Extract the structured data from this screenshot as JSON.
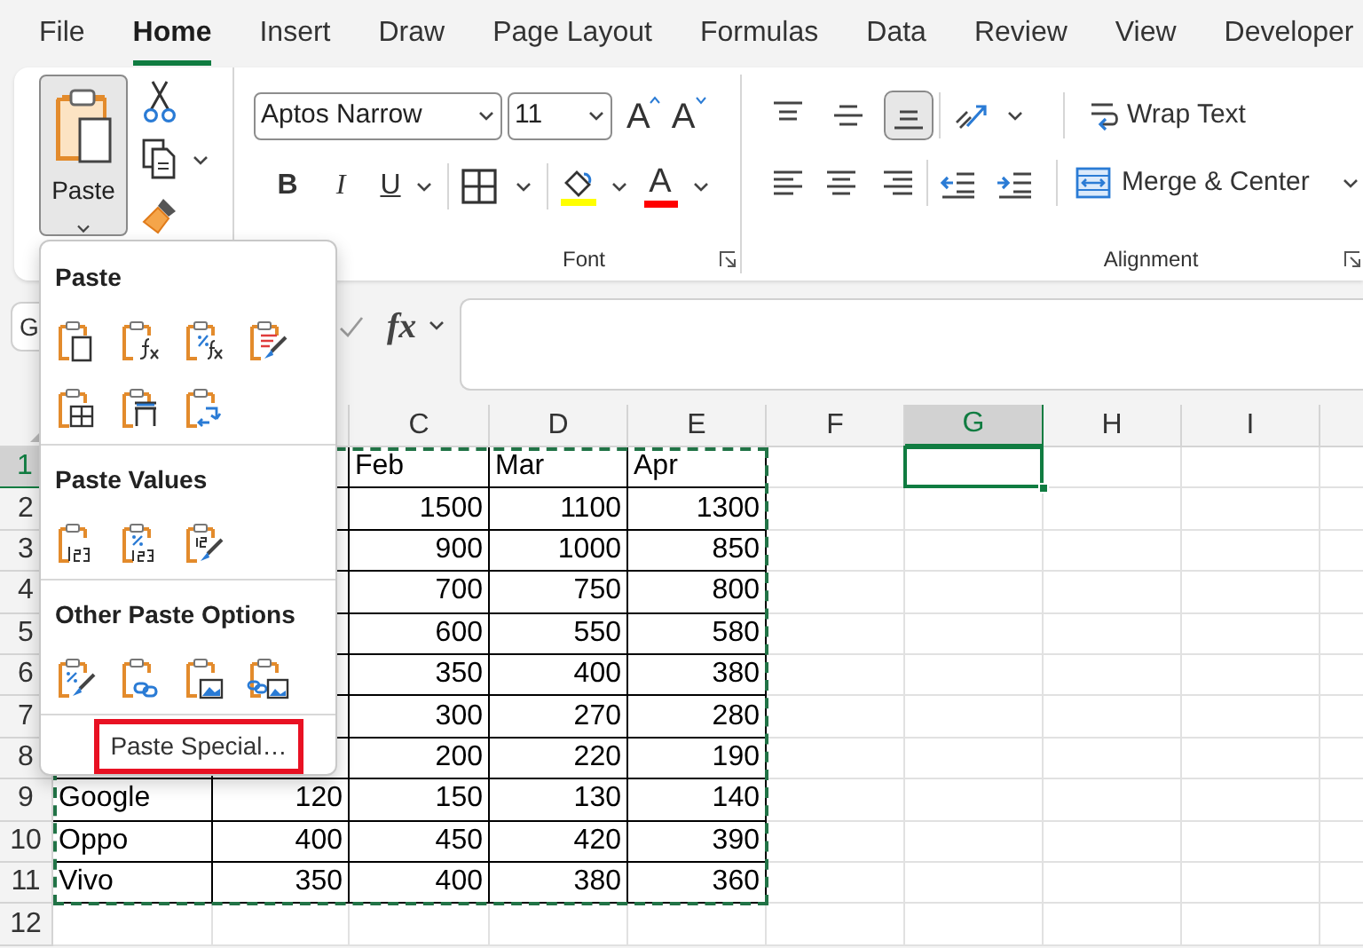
{
  "menu_tabs": [
    {
      "label": "File",
      "selected": false
    },
    {
      "label": "Home",
      "selected": true
    },
    {
      "label": "Insert",
      "selected": false
    },
    {
      "label": "Draw",
      "selected": false
    },
    {
      "label": "Page Layout",
      "selected": false
    },
    {
      "label": "Formulas",
      "selected": false
    },
    {
      "label": "Data",
      "selected": false
    },
    {
      "label": "Review",
      "selected": false
    },
    {
      "label": "View",
      "selected": false
    },
    {
      "label": "Developer",
      "selected": false
    }
  ],
  "clipboard": {
    "paste_label": "Paste"
  },
  "font": {
    "font_name": "Aptos Narrow",
    "font_size": "11",
    "grow_label": "A",
    "shrink_label": "A",
    "bold_label": "B",
    "italic_label": "I",
    "underline_label": "U",
    "font_color_label": "A",
    "group_label": "Font"
  },
  "alignment": {
    "vertical": [
      {
        "kind": "top",
        "selected": false
      },
      {
        "kind": "middle",
        "selected": false
      },
      {
        "kind": "bottom",
        "selected": true
      }
    ],
    "wrap_text": "Wrap Text",
    "merge_center": "Merge & Center",
    "group_label": "Alignment"
  },
  "formula_bar": {
    "name_box": "G",
    "fx_label": "fx"
  },
  "paste_menu": {
    "sections": [
      {
        "title": "Paste",
        "options": [
          {
            "kind": "paste"
          },
          {
            "kind": "formulas"
          },
          {
            "kind": "formulas-number-format"
          },
          {
            "kind": "keep-source"
          },
          {
            "kind": "no-borders"
          },
          {
            "kind": "column-widths"
          },
          {
            "kind": "transpose"
          }
        ]
      },
      {
        "title": "Paste Values",
        "options": [
          {
            "kind": "values"
          },
          {
            "kind": "values-number-format"
          },
          {
            "kind": "values-source-format"
          }
        ]
      },
      {
        "title": "Other Paste Options",
        "options": [
          {
            "kind": "formatting"
          },
          {
            "kind": "link"
          },
          {
            "kind": "picture"
          },
          {
            "kind": "linked-picture"
          }
        ]
      }
    ],
    "paste_special": {
      "label": "Paste Special…",
      "highlighted": true
    }
  },
  "sheet": {
    "copied_range_marked": true,
    "columns": [
      {
        "label": "C",
        "selected": false
      },
      {
        "label": "D",
        "selected": false
      },
      {
        "label": "E",
        "selected": false
      },
      {
        "label": "F",
        "selected": false
      },
      {
        "label": "G",
        "selected": true
      },
      {
        "label": "H",
        "selected": false
      },
      {
        "label": "I",
        "selected": false
      }
    ],
    "rows": [
      {
        "number": "1",
        "selected": true,
        "kind": "labels",
        "column_c": "Feb",
        "column_d": "Mar",
        "column_e": "Apr"
      },
      {
        "number": "2",
        "selected": false,
        "kind": "values",
        "column_c": "1500",
        "column_d": "1100",
        "column_e": "1300"
      },
      {
        "number": "3",
        "selected": false,
        "kind": "values",
        "column_c": "900",
        "column_d": "1000",
        "column_e": "850"
      },
      {
        "number": "4",
        "selected": false,
        "kind": "values",
        "column_c": "700",
        "column_d": "750",
        "column_e": "800"
      },
      {
        "number": "5",
        "selected": false,
        "kind": "values",
        "column_c": "600",
        "column_d": "550",
        "column_e": "580"
      },
      {
        "number": "6",
        "selected": false,
        "kind": "values",
        "column_c": "350",
        "column_d": "400",
        "column_e": "380"
      },
      {
        "number": "7",
        "selected": false,
        "kind": "values",
        "column_c": "300",
        "column_d": "270",
        "column_e": "280"
      },
      {
        "number": "8",
        "selected": false,
        "kind": "values",
        "column_c": "200",
        "column_d": "220",
        "column_e": "190"
      },
      {
        "number": "9",
        "selected": false,
        "kind": "values",
        "column_a": "Google",
        "column_b": "120",
        "column_c": "150",
        "column_d": "130",
        "column_e": "140"
      },
      {
        "number": "10",
        "selected": false,
        "kind": "values",
        "column_a": "Oppo",
        "column_b": "400",
        "column_c": "450",
        "column_d": "420",
        "column_e": "390"
      },
      {
        "number": "11",
        "selected": false,
        "kind": "values",
        "column_a": "Vivo",
        "column_b": "350",
        "column_c": "400",
        "column_d": "380",
        "column_e": "360"
      },
      {
        "number": "12",
        "selected": false,
        "kind": "empty"
      }
    ]
  }
}
